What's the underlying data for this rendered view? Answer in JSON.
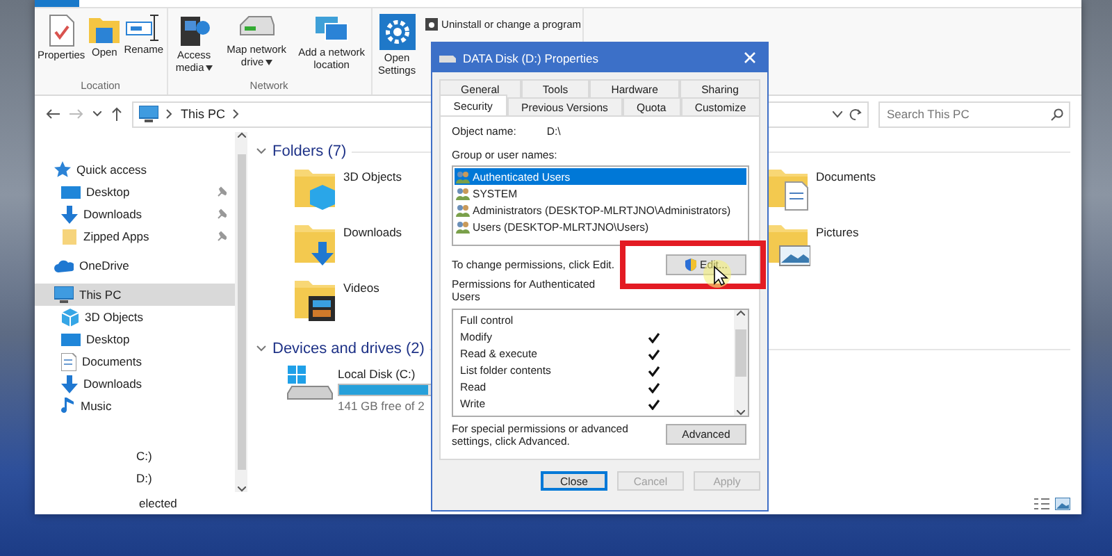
{
  "explorer": {
    "ribbon": {
      "groups": [
        {
          "label": "Location",
          "buttons": [
            {
              "label": "Properties",
              "kind": "properties",
              "dropdown": false
            },
            {
              "label": "Open",
              "kind": "open",
              "dropdown": false
            },
            {
              "label": "Rename",
              "kind": "rename",
              "dropdown": false
            }
          ]
        },
        {
          "label": "Network",
          "buttons": [
            {
              "label": "Access media",
              "kind": "media",
              "dropdown": true
            },
            {
              "label": "Map network drive",
              "kind": "drive",
              "dropdown": true
            },
            {
              "label": "Add a network location",
              "kind": "network",
              "dropdown": false
            }
          ]
        },
        {
          "buttons": [
            {
              "label": "Open Settings",
              "kind": "settings",
              "dropdown": false
            }
          ],
          "small_items": [
            "Uninstall or change a program"
          ]
        }
      ]
    },
    "address": {
      "path": "This PC"
    },
    "search": {
      "placeholder": "Search This PC"
    },
    "nav": [
      {
        "label": "Quick access",
        "kind": "star",
        "selected": false,
        "pinned": false,
        "children": [
          {
            "label": "Desktop",
            "kind": "desktop",
            "selected": false,
            "pinned": true
          },
          {
            "label": "Downloads",
            "kind": "downloads",
            "selected": false,
            "pinned": true
          },
          {
            "label": "Zipped Apps",
            "kind": "folder",
            "selected": false,
            "pinned": true
          }
        ]
      },
      {
        "label": "OneDrive",
        "kind": "cloud",
        "selected": false,
        "pinned": false
      },
      {
        "label": "This PC",
        "kind": "pc",
        "selected": true,
        "pinned": false,
        "children": [
          {
            "label": "3D Objects",
            "kind": "objects",
            "selected": false,
            "pinned": false
          },
          {
            "label": "Desktop",
            "kind": "desktop",
            "selected": false,
            "pinned": false
          },
          {
            "label": "Documents",
            "kind": "documents",
            "selected": false,
            "pinned": false
          },
          {
            "label": "Downloads",
            "kind": "downloads",
            "selected": false,
            "pinned": false
          },
          {
            "label": "Music",
            "kind": "music",
            "selected": false,
            "pinned": false
          }
        ]
      }
    ],
    "nav_fragments": [
      "C:)",
      "D:)"
    ],
    "sections": [
      {
        "title": "Folders (7)",
        "expanded": true,
        "kind": "folders",
        "items": [
          {
            "label": "3D Objects",
            "kind": "objects"
          },
          {
            "label": "Documents",
            "kind": "documents"
          },
          {
            "label": "Downloads",
            "kind": "downloads"
          },
          {
            "label": "Pictures",
            "kind": "pictures"
          },
          {
            "label": "Videos",
            "kind": "videos"
          }
        ]
      },
      {
        "title": "Devices and drives (2)",
        "expanded": true,
        "kind": "drives",
        "items": [
          {
            "label": "Local Disk (C:)",
            "kind": "system_drive",
            "level": 0.53,
            "free": "141 GB free of 2"
          }
        ]
      }
    ],
    "status_bar": {
      "text": "elected"
    }
  },
  "dialog": {
    "title": "DATA Disk (D:) Properties",
    "tab_rows": [
      [
        {
          "label": "General",
          "selected": false
        },
        {
          "label": "Tools",
          "selected": false
        },
        {
          "label": "Hardware",
          "selected": false
        },
        {
          "label": "Sharing",
          "selected": false
        }
      ],
      [
        {
          "label": "Security",
          "selected": true
        },
        {
          "label": "Previous Versions",
          "selected": false
        },
        {
          "label": "Quota",
          "selected": false
        },
        {
          "label": "Customize",
          "selected": false
        }
      ]
    ],
    "object_name": {
      "label": "Object name:",
      "value": "D:\\"
    },
    "groups_label": "Group or user names:",
    "users": [
      {
        "name": "Authenticated Users",
        "selected": true
      },
      {
        "name": "SYSTEM",
        "selected": false
      },
      {
        "name": "Administrators (DESKTOP-MLRTJNO\\Administrators)",
        "selected": false
      },
      {
        "name": "Users (DESKTOP-MLRTJNO\\Users)",
        "selected": false
      }
    ],
    "change_hint": "To change permissions, click Edit.",
    "edit_button": {
      "label": "Edit...",
      "highlighted": true
    },
    "permissions_label": "Permissions for Authenticated Users",
    "permissions": [
      {
        "name": "Full control",
        "allow": false
      },
      {
        "name": "Modify",
        "allow": true
      },
      {
        "name": "Read & execute",
        "allow": true
      },
      {
        "name": "List folder contents",
        "allow": true
      },
      {
        "name": "Read",
        "allow": true
      },
      {
        "name": "Write",
        "allow": true
      }
    ],
    "advanced_hint": "For special permissions or advanced settings, click Advanced.",
    "advanced_button": "Advanced",
    "buttons": [
      {
        "label": "Close",
        "disabled": false,
        "default": true
      },
      {
        "label": "Cancel",
        "disabled": true,
        "default": false
      },
      {
        "label": "Apply",
        "disabled": true,
        "default": false
      }
    ]
  }
}
